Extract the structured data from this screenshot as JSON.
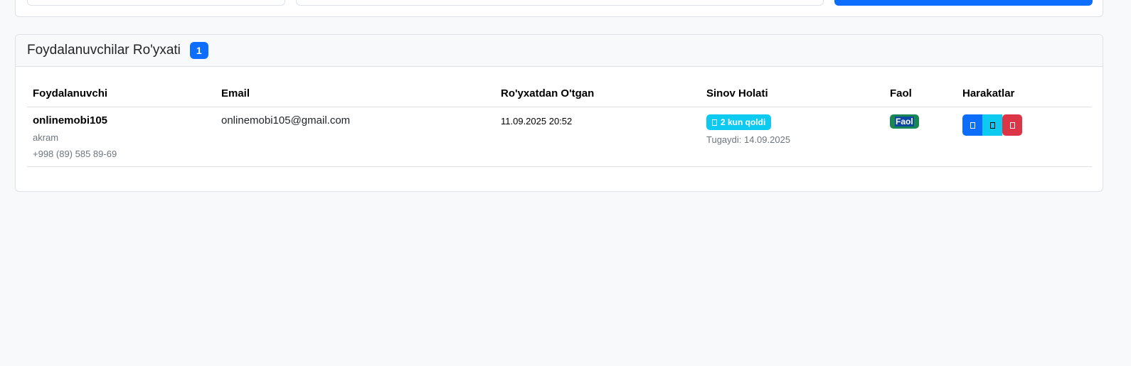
{
  "users_card": {
    "title": "Foydalanuvchilar Ro'yxati",
    "count": "1",
    "columns": {
      "user": "Foydalanuvchi",
      "email": "Email",
      "registered": "Ro'yxatdan O'tgan",
      "trial": "Sinov Holati",
      "active": "Faol",
      "actions": "Harakatlar"
    },
    "rows": [
      {
        "username": "onlinemobi105",
        "name": "akram",
        "phone": "+998 (89) 585 89-69",
        "email": "onlinemobi105@gmail.com",
        "registered": "11.09.2025 20:52",
        "trial_badge": "2 kun qoldi",
        "trial_end": "Tugaydi: 14.09.2025",
        "active_badge": "Faol"
      }
    ]
  },
  "colors": {
    "primary": "#0d6efd",
    "info": "#0dcaf0",
    "success": "#198754",
    "danger": "#dc3545"
  },
  "icons": {
    "trial_badge_icon": "clock-icon",
    "action_view": "eye-icon",
    "action_edit": "edit-icon",
    "action_delete": "trash-icon"
  }
}
